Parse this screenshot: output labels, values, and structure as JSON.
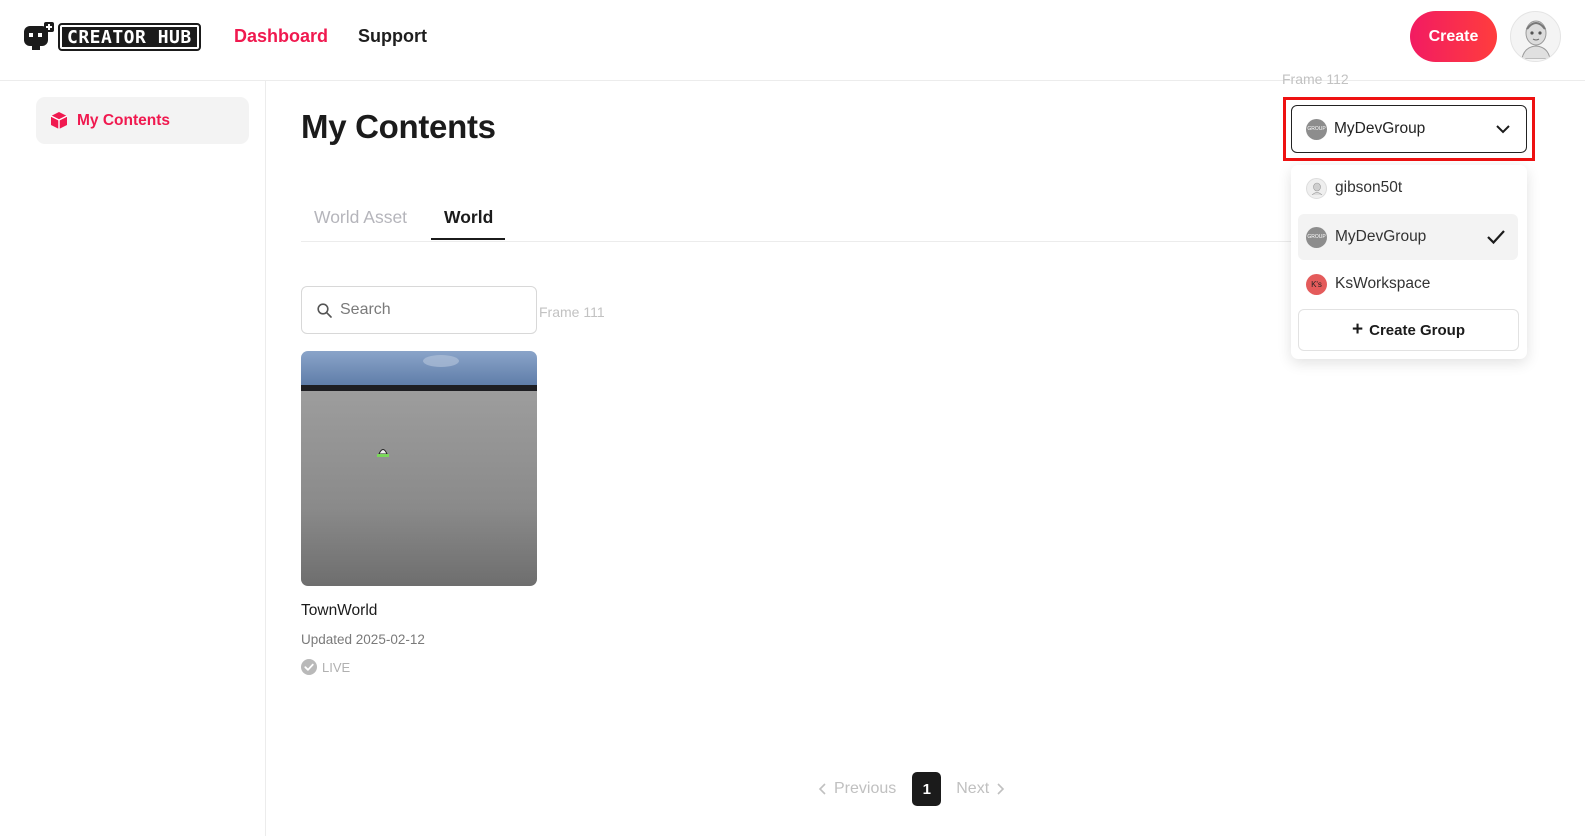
{
  "header": {
    "logo_text": "CREATOR HUB",
    "nav": {
      "dashboard": "Dashboard",
      "support": "Support"
    },
    "create_label": "Create"
  },
  "sidebar": {
    "items": [
      {
        "label": "My Contents",
        "icon": "cube-icon",
        "active": true
      }
    ]
  },
  "main": {
    "title": "My Contents",
    "tabs": [
      {
        "label": "World Asset",
        "active": false
      },
      {
        "label": "World",
        "active": true
      }
    ],
    "search": {
      "placeholder": "Search",
      "value": ""
    },
    "frame_label": "Frame 111",
    "cards": [
      {
        "name": "TownWorld",
        "updated": "Updated 2025-02-12",
        "status": "LIVE"
      }
    ],
    "pagination": {
      "previous": "Previous",
      "current_page": "1",
      "next": "Next"
    }
  },
  "group_selector": {
    "frame_label": "Frame 112",
    "selected": "MyDevGroup",
    "options": [
      {
        "label": "gibson50t",
        "selected": false
      },
      {
        "label": "MyDevGroup",
        "selected": true
      },
      {
        "label": "KsWorkspace",
        "selected": false
      }
    ],
    "create_group_label": "Create Group",
    "group_badge_text": "GROUP",
    "ks_badge_text": "K's"
  },
  "colors": {
    "accent": "#f0194f",
    "highlight_border": "#ee1111",
    "dark": "#1b1b1b"
  }
}
